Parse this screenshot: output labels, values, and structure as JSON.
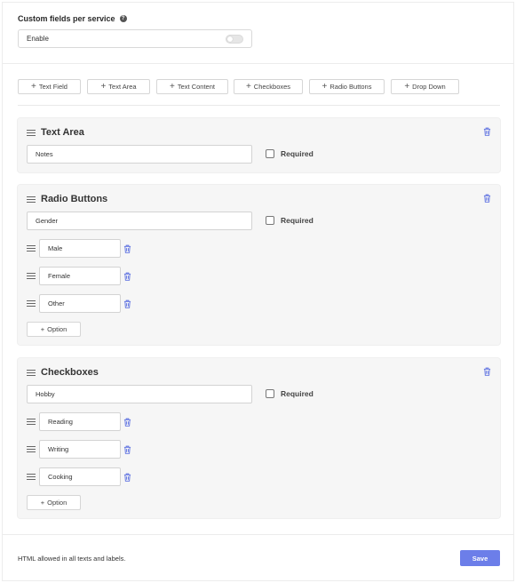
{
  "header": {
    "title": "Custom fields per service",
    "help_icon": "question-circle-icon"
  },
  "enable": {
    "label": "Enable",
    "toggle_on": false
  },
  "field_types": [
    {
      "label": "Text Field"
    },
    {
      "label": "Text Area"
    },
    {
      "label": "Text Content"
    },
    {
      "label": "Checkboxes"
    },
    {
      "label": "Radio Buttons"
    },
    {
      "label": "Drop Down"
    }
  ],
  "fields": [
    {
      "title": "Text Area",
      "value": "Notes",
      "required_label": "Required",
      "required": false,
      "options": []
    },
    {
      "title": "Radio Buttons",
      "value": "Gender",
      "required_label": "Required",
      "required": false,
      "options": [
        "Male",
        "Female",
        "Other"
      ],
      "add_option_label": "Option"
    },
    {
      "title": "Checkboxes",
      "value": "Hobby",
      "required_label": "Required",
      "required": false,
      "options": [
        "Reading",
        "Writing",
        "Cooking"
      ],
      "add_option_label": "Option"
    }
  ],
  "footer": {
    "note": "HTML allowed in all texts and labels.",
    "save_label": "Save"
  },
  "colors": {
    "accent": "#6c7ee9",
    "trash_icon": "#5b6fe0",
    "card_bg": "#f6f6f6"
  }
}
